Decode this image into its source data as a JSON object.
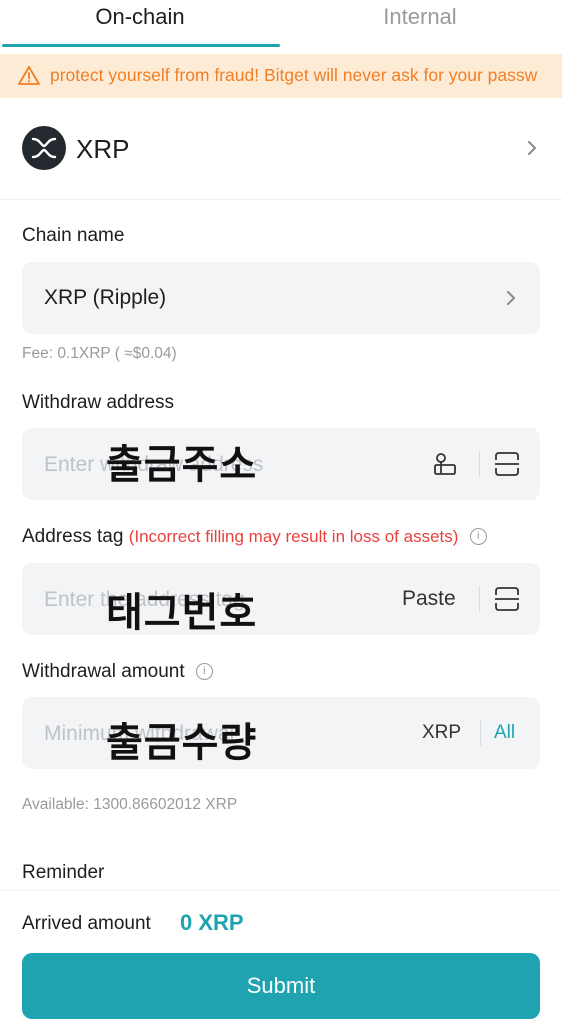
{
  "tabs": {
    "onchain": "On-chain",
    "internal": "Internal"
  },
  "warning": {
    "text": "protect yourself from fraud! Bitget will never ask for your passw",
    "color": "#f07f26"
  },
  "coin": {
    "name": "XRP"
  },
  "chain": {
    "label": "Chain name",
    "value": "XRP (Ripple)",
    "fee": "Fee: 0.1XRP ( ≈$0.04)"
  },
  "address": {
    "label": "Withdraw address",
    "placeholder": "Enter withdraw address",
    "overlay": "출금주소"
  },
  "tag": {
    "label": "Address tag",
    "warning": "(Incorrect filling may result in loss of assets)",
    "placeholder": "Enter the address tag",
    "paste": "Paste",
    "overlay": "태그번호"
  },
  "amount": {
    "label": "Withdrawal amount",
    "placeholder": "Minimum withdrawal",
    "unit": "XRP",
    "all": "All",
    "available": "Available: 1300.86602012 XRP",
    "overlay": "출금수량"
  },
  "reminder": {
    "label": "Reminder"
  },
  "footer": {
    "arrived_label": "Arrived amount",
    "arrived_value": "0 XRP",
    "submit": "Submit"
  },
  "colors": {
    "accent": "#1fa3b0",
    "warning_bg": "#fdebd6",
    "danger": "#e8423f",
    "field_bg": "#f3f4f6"
  }
}
